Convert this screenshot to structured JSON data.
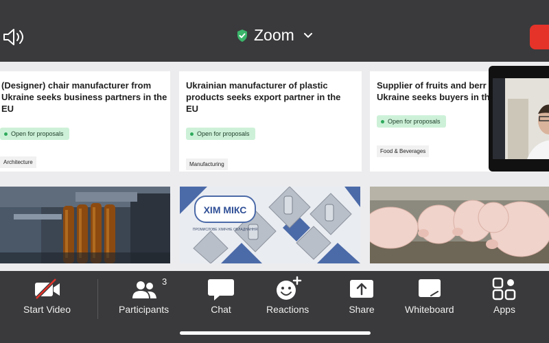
{
  "header": {
    "title": "Zoom",
    "icons": {
      "speaker": "speaker-icon",
      "shield": "shield-check-icon",
      "chevron": "chevron-down-icon"
    },
    "shield_color": "#3ab56a",
    "leave_color": "#e5332a"
  },
  "shared_screen": {
    "cards": [
      {
        "title": "(Designer) chair manufacturer from Ukraine seeks business partners in the EU",
        "status": "Open for proposals",
        "tag": "Architecture"
      },
      {
        "title": "Ukrainian manufacturer of plastic products seeks export partner in the EU",
        "status": "Open for proposals",
        "tag": "Manufacturing"
      },
      {
        "title": "Supplier of fruits and berr Ukraine seeks buyers in th",
        "status": "Open for proposals",
        "tag": "Food & Beverages"
      }
    ],
    "images": [
      {
        "subject": "plastic bottles on production line"
      },
      {
        "subject": "XIM MIKC industrial equipment collage",
        "logo_text": "ХІМ МІКС",
        "logo_subtext": "ПРОМИСЛОВЕ ХІМІЧНЕ ОБЛАДНАННЯ"
      },
      {
        "subject": "pigs in a pen"
      }
    ]
  },
  "toolbar": {
    "start_video": "Start Video",
    "participants": "Participants",
    "participants_count": "3",
    "chat": "Chat",
    "reactions": "Reactions",
    "share": "Share",
    "whiteboard": "Whiteboard",
    "apps": "Apps"
  }
}
